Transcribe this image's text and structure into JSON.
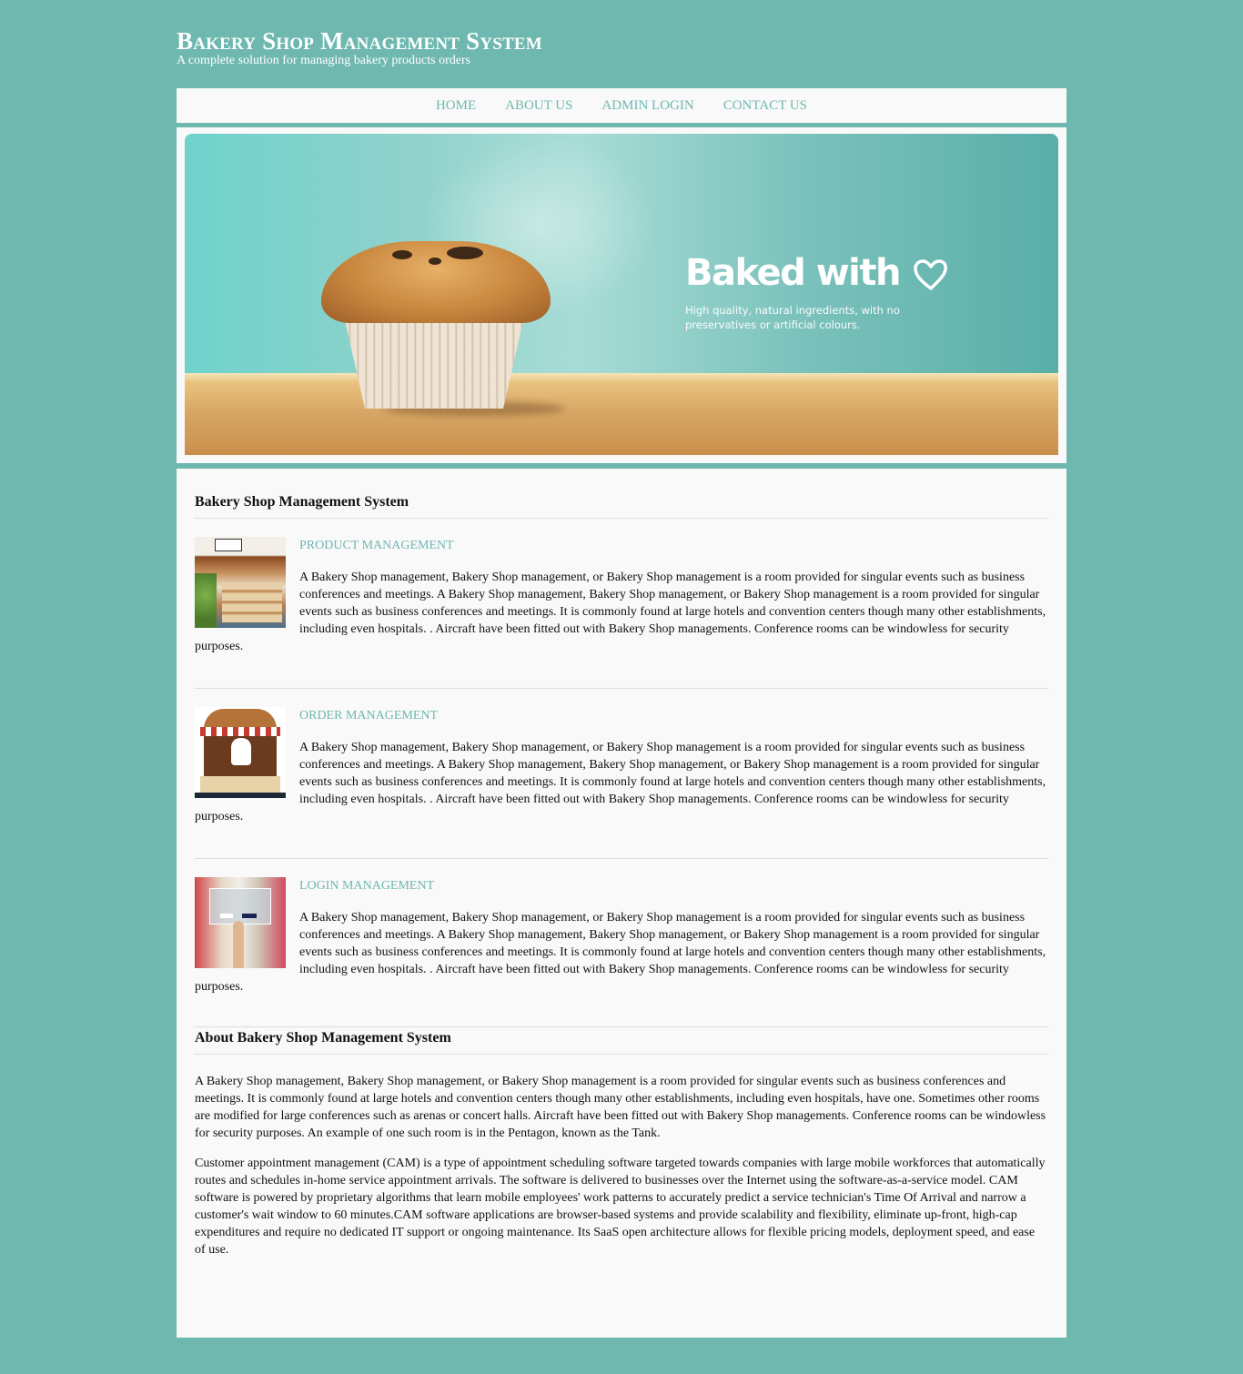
{
  "header": {
    "title": "Bakery Shop Management System",
    "tagline": "A complete solution for managing bakery products orders"
  },
  "nav": {
    "items": [
      {
        "label": "HOME"
      },
      {
        "label": "ABOUT US"
      },
      {
        "label": "ADMIN LOGIN"
      },
      {
        "label": "CONTACT US"
      }
    ]
  },
  "banner": {
    "headline": "Baked with",
    "headline_icon": "heart-outline-icon",
    "subtext": "High quality, natural ingredients, with no preservatives or artificial colours."
  },
  "main": {
    "section_title": "Bakery Shop Management System",
    "features": [
      {
        "title": "PRODUCT MANAGEMENT",
        "image": "bakery-shop-interior-thumbnail",
        "text": "A Bakery Shop management, Bakery Shop management, or Bakery Shop management is a room provided for singular events such as business conferences and meetings. A Bakery Shop management, Bakery Shop management, or Bakery Shop management is a room provided for singular events such as business conferences and meetings. It is commonly found at large hotels and convention centers though many other establishments, including even hospitals. . Aircraft have been fitted out with Bakery Shop managements. Conference rooms can be windowless for security purposes."
      },
      {
        "title": "ORDER MANAGEMENT",
        "image": "bakery-stall-illustration-thumbnail",
        "text": "A Bakery Shop management, Bakery Shop management, or Bakery Shop management is a room provided for singular events such as business conferences and meetings. A Bakery Shop management, Bakery Shop management, or Bakery Shop management is a room provided for singular events such as business conferences and meetings. It is commonly found at large hotels and convention centers though many other establishments, including even hospitals. . Aircraft have been fitted out with Bakery Shop managements. Conference rooms can be windowless for security purposes."
      },
      {
        "title": "LOGIN MANAGEMENT",
        "image": "login-screen-touch-thumbnail",
        "text": "A Bakery Shop management, Bakery Shop management, or Bakery Shop management is a room provided for singular events such as business conferences and meetings. A Bakery Shop management, Bakery Shop management, or Bakery Shop management is a room provided for singular events such as business conferences and meetings. It is commonly found at large hotels and convention centers though many other establishments, including even hospitals. . Aircraft have been fitted out with Bakery Shop managements. Conference rooms can be windowless for security purposes."
      }
    ],
    "about": {
      "title": "About Bakery Shop Management System",
      "paragraphs": [
        "A Bakery Shop management, Bakery Shop management, or Bakery Shop management is a room provided for singular events such as business conferences and meetings. It is commonly found at large hotels and convention centers though many other establishments, including even hospitals, have one. Sometimes other rooms are modified for large conferences such as arenas or concert halls. Aircraft have been fitted out with Bakery Shop managements. Conference rooms can be windowless for security purposes. An example of one such room is in the Pentagon, known as the Tank.",
        "Customer appointment management (CAM) is a type of appointment scheduling software targeted towards companies with large mobile workforces that automatically routes and schedules in-home service appointment arrivals. The software is delivered to businesses over the Internet using the software-as-a-service model. CAM software is powered by proprietary algorithms that learn mobile employees' work patterns to accurately predict a service technician's Time Of Arrival and narrow a customer's wait window to 60 minutes.CAM software applications are browser-based systems and provide scalability and flexibility, eliminate up-front, high-cap expenditures and require no dedicated IT support or ongoing maintenance. Its SaaS open architecture allows for flexible pricing models, deployment speed, and ease of use."
      ]
    }
  },
  "colors": {
    "page_background": "#6fb8b0",
    "accent": "#6fb8b0",
    "panel_background": "#f9f9f9",
    "text": "#111111"
  }
}
